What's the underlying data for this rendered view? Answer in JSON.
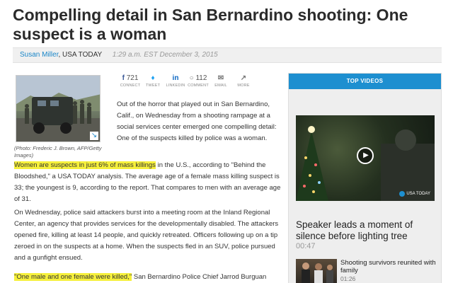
{
  "article": {
    "headline": "Compelling detail in San Bernardino shooting: One suspect is a woman",
    "byline": {
      "author": "Susan Miller",
      "separator": ", ",
      "organization": "USA TODAY",
      "timestamp": "1:29 a.m. EST December 3, 2015"
    },
    "photo": {
      "caption": "(Photo: Frederic J. Brown, AFP/Getty Images)",
      "expand_icon": "expand-arrow-icon"
    },
    "share": {
      "facebook": {
        "count": "721",
        "label": "CONNECT",
        "icon": "facebook-icon"
      },
      "twitter": {
        "label": "TWEET",
        "icon": "twitter-icon"
      },
      "linkedin": {
        "label": "LINKEDIN",
        "icon": "linkedin-icon"
      },
      "comment": {
        "count": "112",
        "label": "COMMENT",
        "icon": "comment-icon"
      },
      "email": {
        "label": "EMAIL",
        "icon": "email-icon"
      },
      "more": {
        "label": "MORE",
        "icon": "more-icon"
      }
    },
    "paragraphs": {
      "p1": "Out of the horror that played out in San Bernardino, Calif., on Wednesday from a shooting rampage at a social services center emerged one compelling detail: One of the suspects killed by police was a woman.",
      "p2_highlight": "Women are  suspects in just 6% of mass killings",
      "p2_rest": " in the U.S., according to \"Behind the Bloodshed,\" a USA TODAY analysis. The average age of a female mass killing suspect is 33; the youngest is 9, according to the report. That compares to men with an average age of 31.",
      "p3": "On Wednesday, police said attackers burst into a meeting room at the Inland Regional Center, an agency that provides services for the developmentally disabled. The attackers opened fire, killing at least 14 people, and quickly retreated. Officers following up on a tip zeroed in on the suspects at a home. When the suspects fled in an SUV, police pursued and a gunfight ensued.",
      "p4_highlight": "\"One male and one female were killed,\"",
      "p4_rest": " San Bernardino Police Chief Jarrod Burguan"
    }
  },
  "top_videos": {
    "header": "TOP VIDEOS",
    "featured": {
      "title": "Speaker leads a moment of silence before lighting tree",
      "duration": "00:47",
      "badge": "USA TODAY",
      "play_icon": "play-icon"
    },
    "second": {
      "title": "Shooting survivors reunited with family",
      "duration": "01:26"
    }
  },
  "colors": {
    "accent": "#1d8fd0",
    "highlight": "#f6f03b",
    "byline_link": "#1a86c8"
  }
}
